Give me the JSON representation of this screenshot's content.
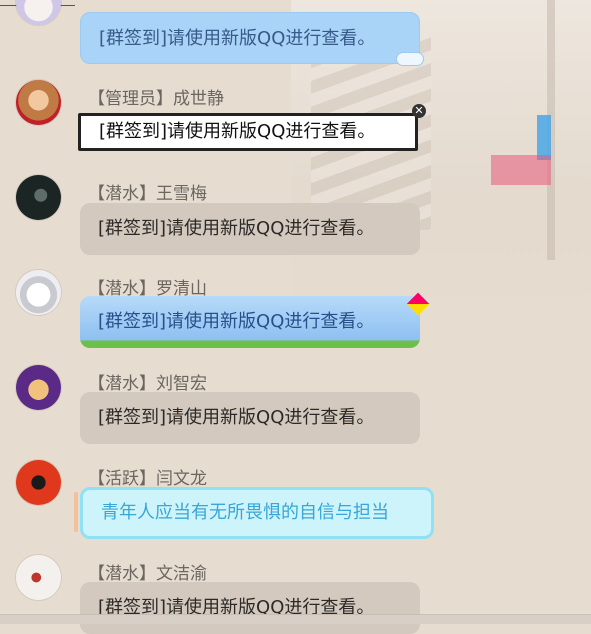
{
  "messages": [
    {
      "role": "",
      "name": "",
      "text": "[群签到]请使用新版QQ进行查看。",
      "style": "blue"
    },
    {
      "role": "【管理员】",
      "name": "成世静",
      "text": "[群签到]请使用新版QQ进行查看。",
      "style": "white"
    },
    {
      "role": "【潜水】",
      "name": "王雪梅",
      "text": "[群签到]请使用新版QQ进行查看。",
      "style": "gray"
    },
    {
      "role": "【潜水】",
      "name": "罗清山",
      "text": "[群签到]请使用新版QQ进行查看。",
      "style": "grass"
    },
    {
      "role": "【潜水】",
      "name": "刘智宏",
      "text": "[群签到]请使用新版QQ进行查看。",
      "style": "gray"
    },
    {
      "role": "【活跃】",
      "name": "闫文龙",
      "text": "青年人应当有无所畏惧的自信与担当",
      "style": "cyan"
    },
    {
      "role": "【潜水】",
      "name": "文洁渝",
      "text": "[群签到]请使用新版QQ进行查看。",
      "style": "gray"
    }
  ],
  "avatars": [
    "anime-avatar",
    "hamster-avatar",
    "dark-portrait-avatar",
    "anime-boy-avatar",
    "cartoon-face-avatar",
    "red-silhouette-avatar",
    "sketch-avatar"
  ],
  "colors": {
    "bg": "#e6dcd0",
    "bubble_gray": "#d3c9be",
    "bubble_blue": "#a9d3f7",
    "bubble_cyan": "#cdf4fb",
    "sender": "#6b6660"
  }
}
